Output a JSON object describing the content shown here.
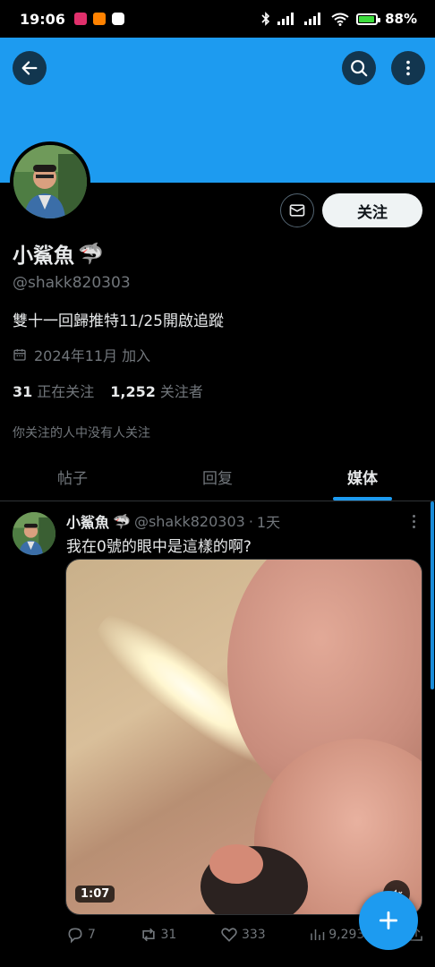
{
  "status_bar": {
    "time": "19:06",
    "battery": "88",
    "battery_percent_sign": "%",
    "icons": [
      "instagram-icon",
      "weibo-icon",
      "app-icon",
      "bluetooth-icon",
      "signal-icon",
      "signal-hd-icon",
      "wifi-icon",
      "battery-icon"
    ]
  },
  "header": {
    "banner_color": "#1d9bf0",
    "back_icon": "arrow-left-icon",
    "search_icon": "search-icon",
    "more_icon": "more-vertical-icon"
  },
  "profile": {
    "name": "小鯊魚",
    "name_emoji": "🦈",
    "handle": "@shakk820303",
    "bio": "雙十一回歸推特11/25開啟追蹤",
    "joined": "2024年11月 加入",
    "following_count": "31",
    "following_label": "正在关注",
    "followers_count": "1,252",
    "followers_label": "关注者",
    "followers_you_know": "你关注的人中没有人关注",
    "follow_button": "关注",
    "message_icon": "mail-icon"
  },
  "tabs": [
    {
      "label": "帖子",
      "active": false
    },
    {
      "label": "回复",
      "active": false
    },
    {
      "label": "媒体",
      "active": true
    }
  ],
  "post": {
    "author_name": "小鯊魚",
    "author_emoji": "🦈",
    "author_handle": "@shakk820303",
    "separator": "·",
    "time": "1天",
    "text": "我在0號的眼中是這樣的啊?",
    "video_duration": "1:07",
    "replies": "7",
    "reposts": "31",
    "likes": "333",
    "views": "9,293"
  },
  "colors": {
    "accent": "#1d9bf0",
    "text_primary": "#e7e9ea",
    "text_secondary": "#71767b",
    "background": "#000000"
  }
}
